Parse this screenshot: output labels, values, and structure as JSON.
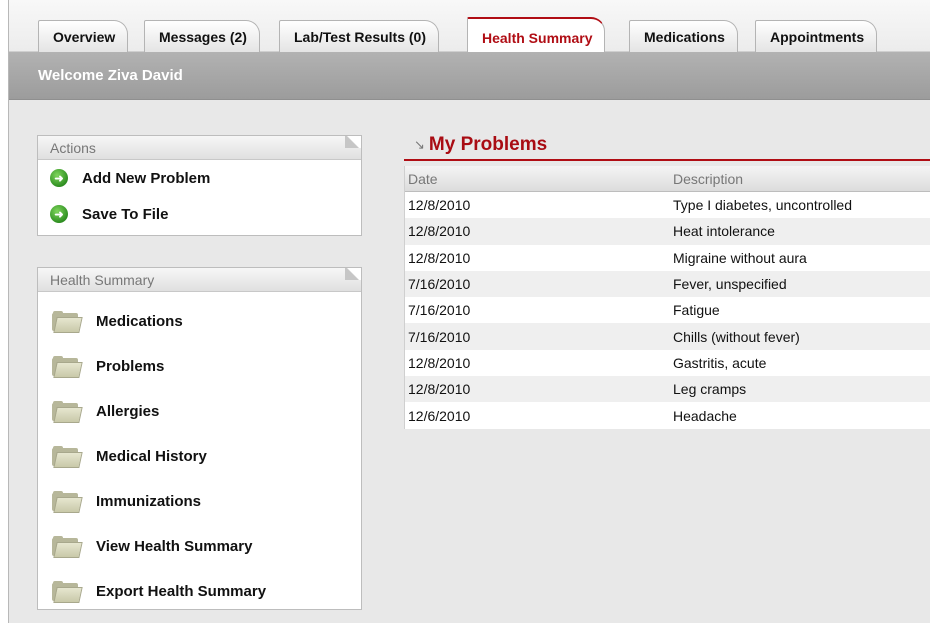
{
  "tabs": [
    {
      "label": "Overview",
      "active": false
    },
    {
      "label": "Messages (2)",
      "active": false
    },
    {
      "label": "Lab/Test Results (0)",
      "active": false
    },
    {
      "label": "Health Summary",
      "active": true
    },
    {
      "label": "Medications",
      "active": false
    },
    {
      "label": "Appointments",
      "active": false
    }
  ],
  "welcome": "Welcome Ziva David",
  "actions": {
    "title": "Actions",
    "items": [
      {
        "label": "Add New Problem",
        "icon": "go-arrow-icon"
      },
      {
        "label": "Save To File",
        "icon": "go-arrow-icon"
      }
    ]
  },
  "health_summary": {
    "title": "Health Summary",
    "items": [
      {
        "label": "Medications",
        "icon": "folder-icon"
      },
      {
        "label": "Problems",
        "icon": "folder-icon"
      },
      {
        "label": "Allergies",
        "icon": "folder-icon"
      },
      {
        "label": "Medical History",
        "icon": "folder-icon"
      },
      {
        "label": "Immunizations",
        "icon": "folder-icon"
      },
      {
        "label": "View Health Summary",
        "icon": "folder-icon"
      },
      {
        "label": "Export Health Summary",
        "icon": "folder-icon"
      }
    ]
  },
  "problems": {
    "title": "My Problems",
    "columns": [
      "Date",
      "Description"
    ],
    "rows": [
      [
        "12/8/2010",
        "Type I diabetes, uncontrolled"
      ],
      [
        "12/8/2010",
        "Heat intolerance"
      ],
      [
        "12/8/2010",
        "Migraine without aura"
      ],
      [
        "7/16/2010",
        "Fever, unspecified"
      ],
      [
        "7/16/2010",
        "Fatigue"
      ],
      [
        "7/16/2010",
        "Chills (without fever)"
      ],
      [
        "12/8/2010",
        "Gastritis, acute"
      ],
      [
        "12/8/2010",
        "Leg cramps"
      ],
      [
        "12/6/2010",
        "Headache"
      ]
    ]
  },
  "colors": {
    "accent": "#b00d14",
    "header_bar": "#a8a8a8"
  }
}
